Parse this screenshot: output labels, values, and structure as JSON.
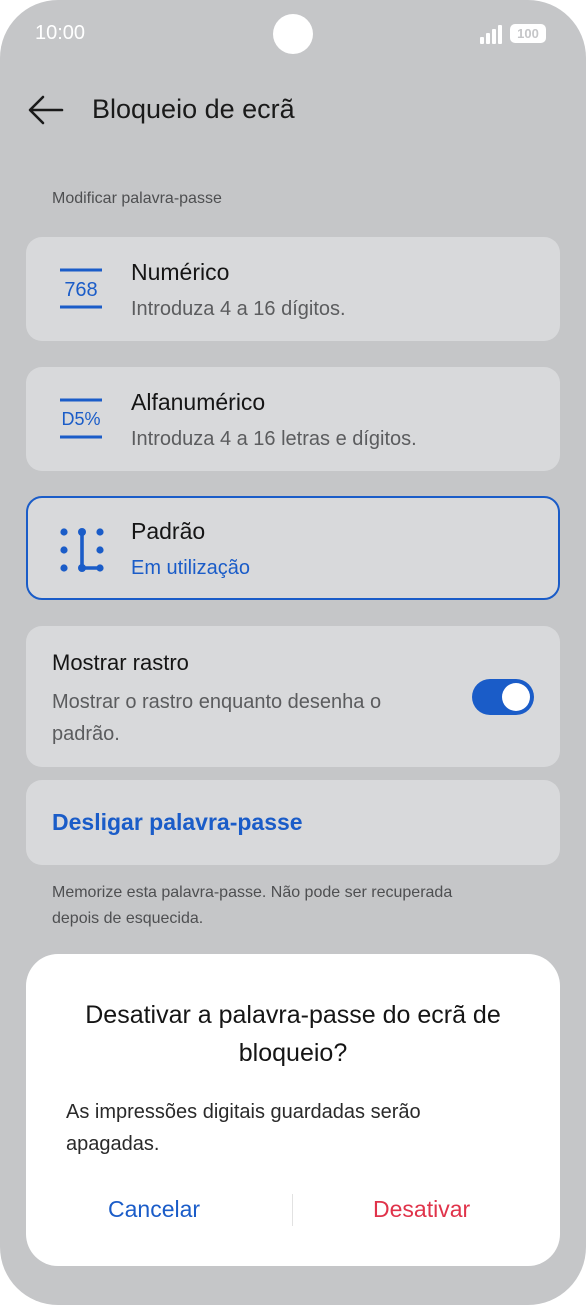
{
  "status_bar": {
    "time": "10:00",
    "battery": "100"
  },
  "header": {
    "title": "Bloqueio de ecrã"
  },
  "section_label": "Modificar palavra-passe",
  "options": [
    {
      "icon": "numeric-icon",
      "icon_text": "768",
      "title": "Numérico",
      "subtitle": "Introduza 4 a 16 dígitos."
    },
    {
      "icon": "alphanumeric-icon",
      "icon_text": "D5%",
      "title": "Alfanumérico",
      "subtitle": "Introduza 4 a 16 letras e dígitos."
    },
    {
      "icon": "pattern-icon",
      "title": "Padrão",
      "subtitle": "Em utilização",
      "selected": true
    }
  ],
  "show_trace": {
    "title": "Mostrar rastro",
    "description": "Mostrar o rastro enquanto desenha o padrão.",
    "enabled": true
  },
  "disable_password": {
    "label": "Desligar palavra-passe"
  },
  "note": "Memorize esta palavra-passe. Não pode ser recuperada depois de esquecida.",
  "dialog": {
    "title": "Desativar a palavra-passe do ecrã de bloqueio?",
    "message": "As impressões digitais guardadas serão apagadas.",
    "cancel": "Cancelar",
    "confirm": "Desativar"
  },
  "colors": {
    "accent": "#1a5cc8",
    "danger": "#e0334a",
    "dim_background": "#c5c6c8",
    "card": "#d8d9db"
  }
}
